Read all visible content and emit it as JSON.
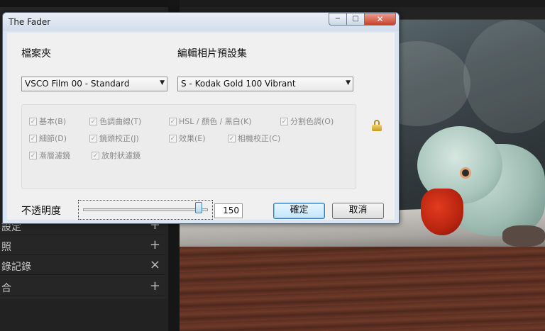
{
  "dialog": {
    "title": "The Fader",
    "window_buttons": {
      "minimize": "−",
      "maximize": "□",
      "close": "✕"
    },
    "folder_label": "檔案夾",
    "preset_label": "編輯相片預設集",
    "folder_value": "VSCO Film 00 - Standard",
    "preset_value": "S - Kodak Gold 100 Vibrant",
    "checkboxes": [
      {
        "label": "基本(B)",
        "checked": true
      },
      {
        "label": "色調曲線(T)",
        "checked": true
      },
      {
        "label": "HSL / 顏色 / 黑白(K)",
        "checked": true
      },
      {
        "label": "分割色調(O)",
        "checked": true
      },
      {
        "label": "細節(D)",
        "checked": true
      },
      {
        "label": "鏡頭校正(J)",
        "checked": true
      },
      {
        "label": "效果(E)",
        "checked": true
      },
      {
        "label": "相機校正(C)",
        "checked": true
      },
      {
        "label": "漸層濾鏡",
        "checked": true
      },
      {
        "label": "放射狀濾鏡",
        "checked": true
      }
    ],
    "opacity_label": "不透明度",
    "opacity_value": "150",
    "slider_fraction": 0.95,
    "ok_label": "確定",
    "cancel_label": "取消",
    "lock_icon": "lock-icon"
  },
  "lightroom": {
    "panels": [
      {
        "label": "設定",
        "action": "+"
      },
      {
        "label": "照",
        "action": "+"
      },
      {
        "label": "錄記錄",
        "action": "×"
      },
      {
        "label": "合",
        "action": "+"
      }
    ]
  }
}
